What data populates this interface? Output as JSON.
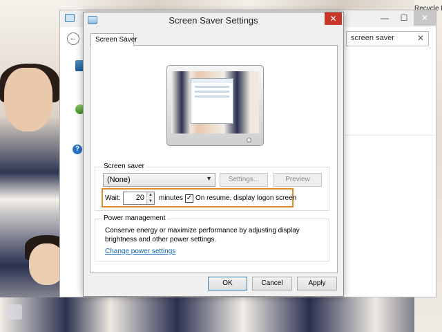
{
  "desktop": {
    "recycle_bin_label": "Recycle B"
  },
  "control_panel": {
    "search": {
      "value": "screen saver",
      "clear_glyph": "✕"
    },
    "back_glyph": "←",
    "minimize_glyph": "—",
    "maximize_glyph": "☐",
    "close_glyph": "✕",
    "help_glyph": "?"
  },
  "dialog": {
    "title": "Screen Saver Settings",
    "close_glyph": "✕",
    "tab_label": "Screen Saver",
    "screen_saver_group": {
      "label": "Screen saver",
      "selected": "(None)",
      "dropdown_glyph": "▼",
      "settings_button": "Settings...",
      "preview_button": "Preview",
      "wait_label": "Wait:",
      "wait_value": "20",
      "spin_up_glyph": "▲",
      "spin_down_glyph": "▼",
      "minutes_label": "minutes",
      "logon_checked": true,
      "check_glyph": "✓",
      "logon_label": "On resume, display logon screen"
    },
    "power_group": {
      "label": "Power management",
      "description": "Conserve energy or maximize performance by adjusting display brightness and other power settings.",
      "link": "Change power settings"
    },
    "buttons": {
      "ok": "OK",
      "cancel": "Cancel",
      "apply": "Apply"
    }
  },
  "colors": {
    "highlight_border": "#e08a2a",
    "close_button": "#c7382a",
    "link": "#0b61b5"
  }
}
